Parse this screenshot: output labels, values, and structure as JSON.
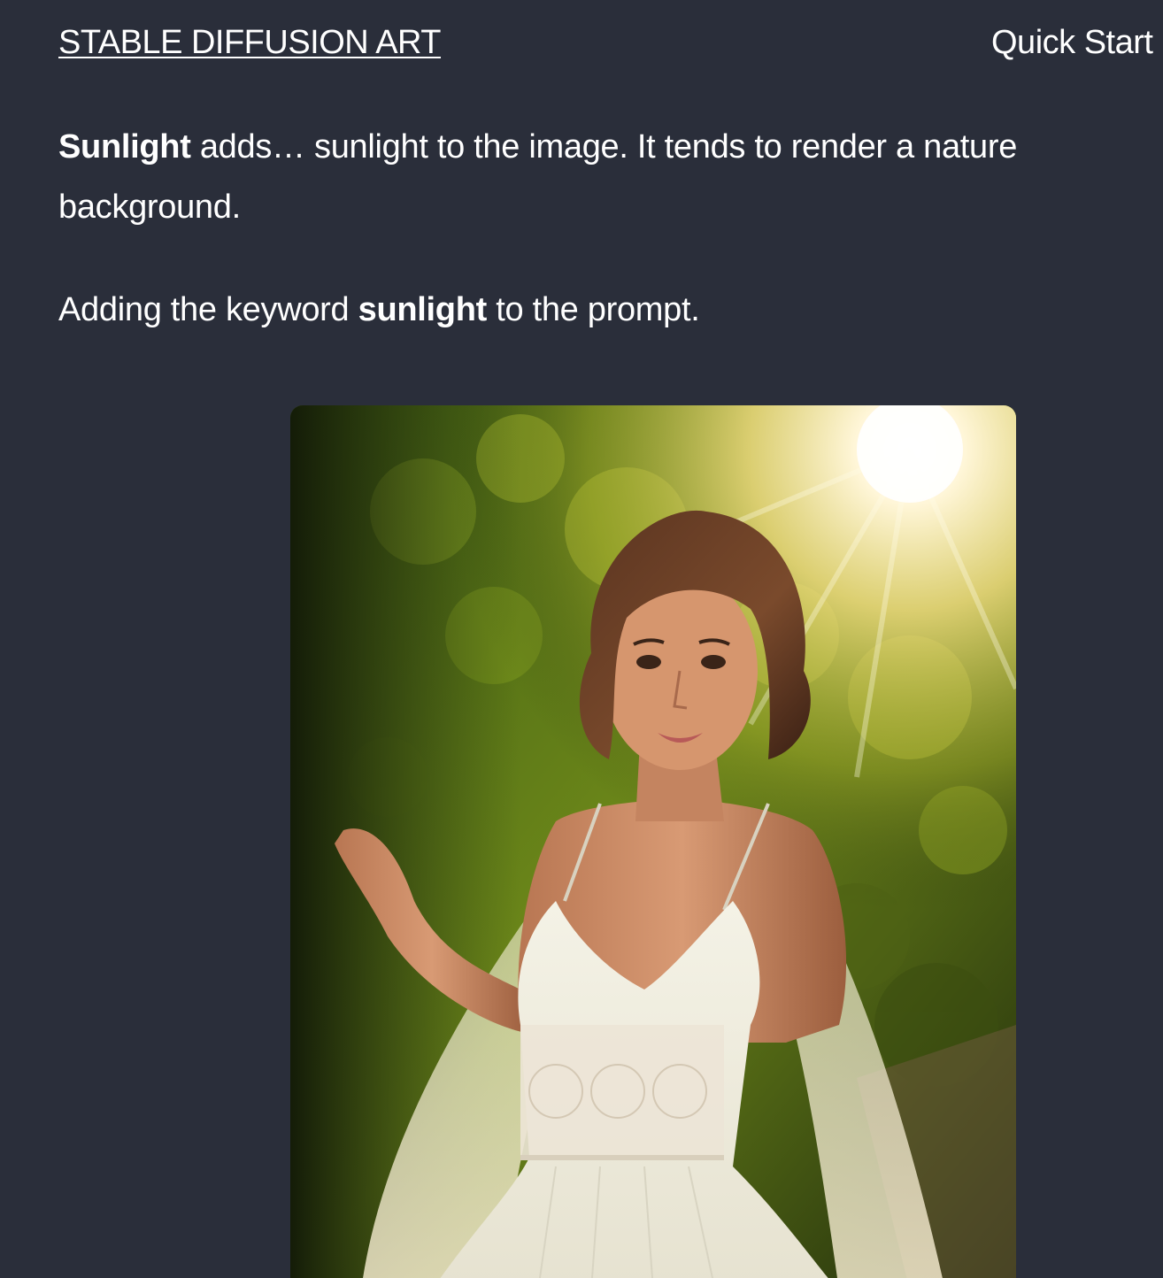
{
  "header": {
    "site_title": "STABLE DIFFUSION ART",
    "nav_item": "Quick Start"
  },
  "article": {
    "para1": {
      "bold": "Sunlight",
      "rest": " adds… sunlight to the image. It tends to render a nature background."
    },
    "para2": {
      "before": "Adding the keyword ",
      "bold": "sunlight",
      "after": " to the prompt."
    }
  },
  "colors": {
    "background": "#2a2e3a",
    "text": "#ffffff"
  }
}
